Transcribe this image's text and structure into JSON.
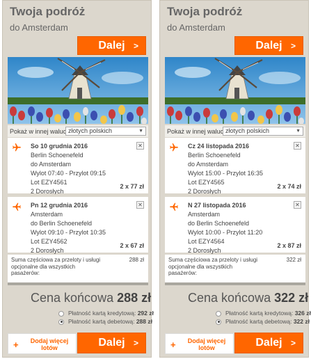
{
  "colors": {
    "accent": "#ff6600",
    "panel": "#dcd7cd"
  },
  "panels": [
    {
      "title": "Twoja podróż",
      "subtitle": "do Amsterdam",
      "next_label": "Dalej",
      "currency_label": "Pokaż w innej walucie",
      "currency_value": "złotych polskich",
      "flights": [
        {
          "date": "So 10 grudnia 2016",
          "from": "Berlin Schoenefeld",
          "to": "do Amsterdam",
          "times": "Wylot 07:40 - Przylot 09:15",
          "flight_no": "Lot EZY4561",
          "passengers": "2 Dorosłych",
          "price": "2 x 77 zł"
        },
        {
          "date": "Pn 12 grudnia 2016",
          "from": "Amsterdam",
          "to": "do Berlin Schoenefeld",
          "times": "Wylot 09:10 - Przylot 10:35",
          "flight_no": "Lot EZY4562",
          "passengers": "2 Dorosłych",
          "price": "2 x 67 zł"
        }
      ],
      "summary_text": "Suma częściowa za przeloty i usługi opcjonalne dla wszystkich pasażerów:",
      "summary_value": "288 zł",
      "final_label": "Cena końcowa",
      "final_value": "288 zł",
      "payment": [
        {
          "label": "Płatność kartą kredytową:",
          "value": "292 zł",
          "selected": false
        },
        {
          "label": "Płatność kartą debetową:",
          "value": "288 zł",
          "selected": true
        }
      ],
      "add_more_label": "Dodaj więcej lotów",
      "bottom_next_label": "Dalej"
    },
    {
      "title": "Twoja podróż",
      "subtitle": "do Amsterdam",
      "next_label": "Dalej",
      "currency_label": "Pokaż w innej walucie",
      "currency_value": "złotych polskich",
      "flights": [
        {
          "date": "Cz 24 listopada 2016",
          "from": "Berlin Schoenefeld",
          "to": "do Amsterdam",
          "times": "Wylot 15:00 - Przylot 16:35",
          "flight_no": "Lot EZY4565",
          "passengers": "2 Dorosłych",
          "price": "2 x 74 zł"
        },
        {
          "date": "N 27 listopada 2016",
          "from": "Amsterdam",
          "to": "do Berlin Schoenefeld",
          "times": "Wylot 10:00 - Przylot 11:20",
          "flight_no": "Lot EZY4564",
          "passengers": "2 Dorosłych",
          "price": "2 x 87 zł"
        }
      ],
      "summary_text": "Suma częściowa za przeloty i usługi opcjonalne dla wszystkich pasażerów:",
      "summary_value": "322 zł",
      "final_label": "Cena końcowa",
      "final_value": "322 zł",
      "payment": [
        {
          "label": "Płatność kartą kredytową:",
          "value": "326 zł",
          "selected": false
        },
        {
          "label": "Płatność kartą debetową:",
          "value": "322 zł",
          "selected": true
        }
      ],
      "add_more_label": "Dodaj więcej lotów",
      "bottom_next_label": "Dalej"
    }
  ]
}
